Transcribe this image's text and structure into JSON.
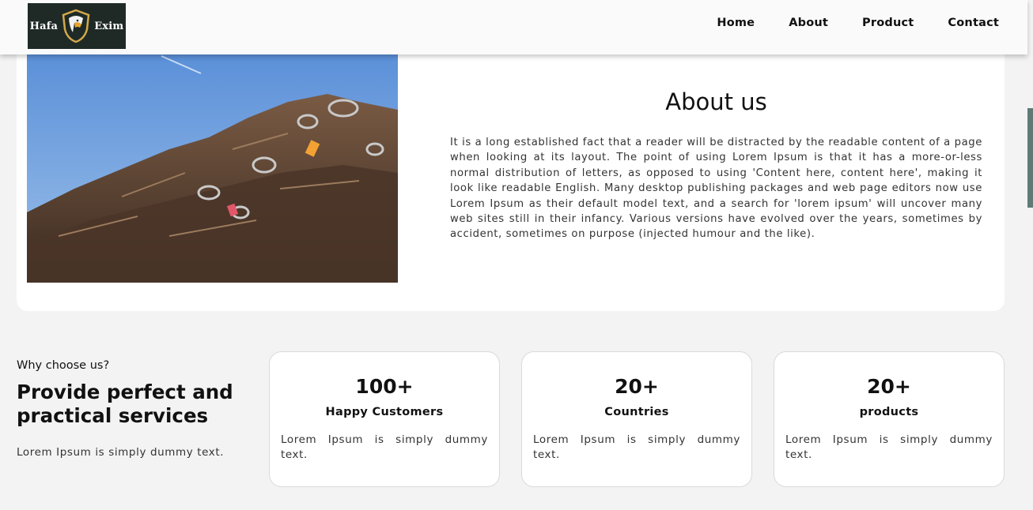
{
  "brand": {
    "logo_left": "Hafa",
    "logo_right": "Exim",
    "bg_color": "#1f2a26"
  },
  "nav": {
    "items": [
      "Home",
      "About",
      "Product",
      "Contact"
    ]
  },
  "about": {
    "title": "About us",
    "image_icon": "scrap-metal-photo",
    "text": "It is a long established fact that a reader will be distracted by the readable content of a page when looking at its layout. The point of using Lorem Ipsum is that it has a more-or-less normal distribution of letters, as opposed to using 'Content here, content here', making it look like readable English. Many desktop publishing packages and web page editors now use Lorem Ipsum as their default model text, and a search for 'lorem ipsum' will uncover many web sites still in their infancy. Various versions have evolved over the years, sometimes by accident, sometimes on purpose (injected humour and the like)."
  },
  "why": {
    "small": "Why choose us?",
    "heading": "Provide perfect and practical services",
    "desc": "Lorem Ipsum is simply dummy text."
  },
  "stats": [
    {
      "num": "100+",
      "label": "Happy Customers",
      "desc": "Lorem Ipsum is simply dummy text."
    },
    {
      "num": "20+",
      "label": "Countries",
      "desc": "Lorem Ipsum is simply dummy text."
    },
    {
      "num": "20+",
      "label": "products",
      "desc": "Lorem Ipsum is simply dummy text."
    }
  ],
  "colors": {
    "page_bg": "#f3f3f3",
    "card_bg": "#ffffff",
    "accent": "#5f7a75"
  }
}
